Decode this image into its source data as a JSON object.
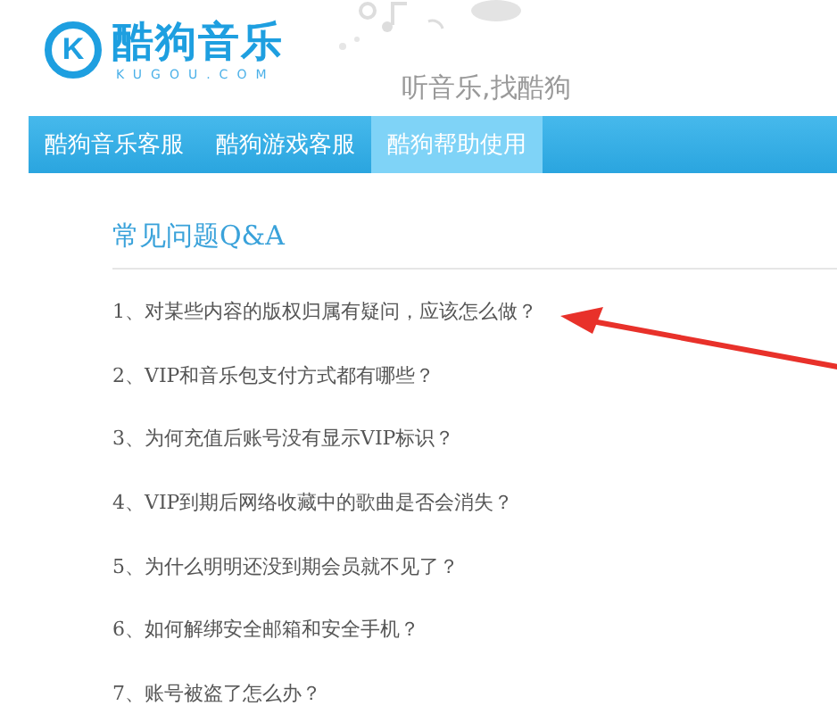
{
  "header": {
    "logo_letter": "K",
    "logo_name": "酷狗音乐",
    "logo_domain": "KUGOU.COM",
    "slogan": "听音乐,找酷狗"
  },
  "nav": [
    {
      "label": "酷狗音乐客服",
      "selected": false
    },
    {
      "label": "酷狗游戏客服",
      "selected": false
    },
    {
      "label": "酷狗帮助使用",
      "selected": true
    }
  ],
  "faq": {
    "title": "常见问题Q&A",
    "questions": [
      "1、对某些内容的版权归属有疑问，应该怎么做？",
      "2、VIP和音乐包支付方式都有哪些？",
      "3、为何充值后账号没有显示VIP标识？",
      "4、VIP到期后网络收藏中的歌曲是否会消失？",
      "5、为什么明明还没到期会员就不见了？",
      "6、如何解绑安全邮箱和安全手机？",
      "7、账号被盗了怎么办？"
    ]
  }
}
